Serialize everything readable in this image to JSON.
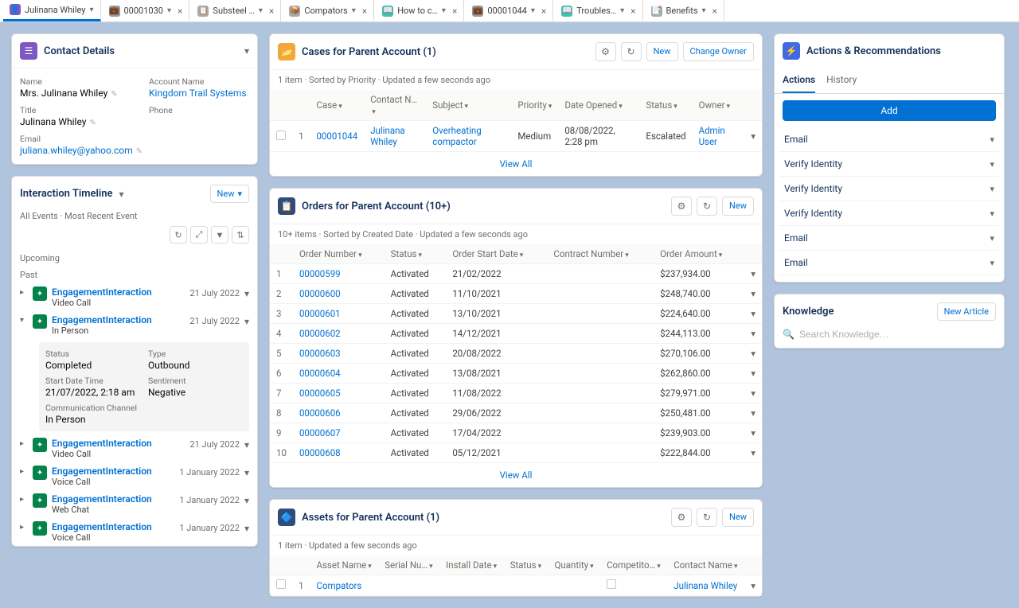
{
  "tabs": [
    {
      "label": "Julinana Whiley",
      "icon": "👤",
      "color": "#7f57c4",
      "close": false,
      "active": true
    },
    {
      "label": "00001030",
      "icon": "💼",
      "color": "#999",
      "close": true
    },
    {
      "label": "Substeel …",
      "icon": "📋",
      "color": "#aaa",
      "close": true
    },
    {
      "label": "Compators",
      "icon": "📦",
      "color": "#aaa",
      "close": true
    },
    {
      "label": "How to c…",
      "icon": "📖",
      "color": "#3cc2b3",
      "close": true
    },
    {
      "label": "00001044",
      "icon": "💼",
      "color": "#999",
      "close": true
    },
    {
      "label": "Troubles…",
      "icon": "📖",
      "color": "#3cc2b3",
      "close": true
    },
    {
      "label": "Benefits",
      "icon": "📑",
      "color": "#aaa",
      "close": true
    }
  ],
  "contactDetails": {
    "title": "Contact Details",
    "fields": {
      "name": {
        "label": "Name",
        "value": "Mrs. Julinana Whiley"
      },
      "account": {
        "label": "Account Name",
        "value": "Kingdom Trail Systems",
        "link": true
      },
      "title": {
        "label": "Title",
        "value": "Julinana Whiley"
      },
      "phone": {
        "label": "Phone",
        "value": ""
      },
      "email": {
        "label": "Email",
        "value": "juliana.whiley@yahoo.com",
        "link": true
      }
    }
  },
  "timeline": {
    "title": "Interaction Timeline",
    "newLabel": "New",
    "filterNote": "All Events · Most Recent Event",
    "sections": {
      "upcoming": "Upcoming",
      "past": "Past"
    },
    "items": [
      {
        "exp": ">",
        "title": "EngagementInteraction",
        "sub": "Video Call",
        "date": "21 July 2022"
      },
      {
        "exp": "v",
        "title": "EngagementInteraction",
        "sub": "In Person",
        "date": "21 July 2022",
        "detail": {
          "status": {
            "label": "Status",
            "value": "Completed"
          },
          "type": {
            "label": "Type",
            "value": "Outbound"
          },
          "start": {
            "label": "Start Date Time",
            "value": "21/07/2022, 2:18 am"
          },
          "sentiment": {
            "label": "Sentiment",
            "value": "Negative"
          },
          "channel": {
            "label": "Communication Channel",
            "value": "In Person"
          }
        }
      },
      {
        "exp": ">",
        "title": "EngagementInteraction",
        "sub": "Video Call",
        "date": "21 July 2022"
      },
      {
        "exp": ">",
        "title": "EngagementInteraction",
        "sub": "Voice Call",
        "date": "1 January 2022"
      },
      {
        "exp": ">",
        "title": "EngagementInteraction",
        "sub": "Web Chat",
        "date": "1 January 2022"
      },
      {
        "exp": ">",
        "title": "EngagementInteraction",
        "sub": "Voice Call",
        "date": "1 January 2022"
      }
    ]
  },
  "cases": {
    "title": "Cases for Parent Account (1)",
    "sub": "1 item · Sorted by Priority · Updated a few seconds ago",
    "btns": {
      "gear": "⚙",
      "refresh": "↻",
      "new": "New",
      "changeOwner": "Change Owner"
    },
    "cols": [
      "Case",
      "Contact N…",
      "Subject",
      "Priority",
      "Date Opened",
      "Status",
      "Owner"
    ],
    "row": {
      "idx": "1",
      "case": "00001044",
      "contact": "Julinana Whiley",
      "subject": "Overheating compactor",
      "priority": "Medium",
      "date": "08/08/2022, 2:28 pm",
      "status": "Escalated",
      "owner": "Admin User"
    },
    "viewAll": "View All"
  },
  "orders": {
    "title": "Orders for Parent Account (10+)",
    "sub": "10+ items · Sorted by Created Date · Updated a few seconds ago",
    "btns": {
      "gear": "⚙",
      "refresh": "↻",
      "new": "New"
    },
    "cols": [
      "Order Number",
      "Status",
      "Order Start Date",
      "Contract Number",
      "Order Amount"
    ],
    "rows": [
      {
        "idx": "1",
        "num": "00000599",
        "status": "Activated",
        "date": "21/02/2022",
        "contract": "",
        "amt": "$237,934.00"
      },
      {
        "idx": "2",
        "num": "00000600",
        "status": "Activated",
        "date": "11/10/2021",
        "contract": "",
        "amt": "$248,740.00"
      },
      {
        "idx": "3",
        "num": "00000601",
        "status": "Activated",
        "date": "13/10/2021",
        "contract": "",
        "amt": "$224,640.00"
      },
      {
        "idx": "4",
        "num": "00000602",
        "status": "Activated",
        "date": "14/12/2021",
        "contract": "",
        "amt": "$244,113.00"
      },
      {
        "idx": "5",
        "num": "00000603",
        "status": "Activated",
        "date": "20/08/2022",
        "contract": "",
        "amt": "$270,106.00"
      },
      {
        "idx": "6",
        "num": "00000604",
        "status": "Activated",
        "date": "13/08/2021",
        "contract": "",
        "amt": "$262,860.00"
      },
      {
        "idx": "7",
        "num": "00000605",
        "status": "Activated",
        "date": "11/08/2022",
        "contract": "",
        "amt": "$279,971.00"
      },
      {
        "idx": "8",
        "num": "00000606",
        "status": "Activated",
        "date": "29/06/2022",
        "contract": "",
        "amt": "$250,481.00"
      },
      {
        "idx": "9",
        "num": "00000607",
        "status": "Activated",
        "date": "17/04/2022",
        "contract": "",
        "amt": "$239,903.00"
      },
      {
        "idx": "10",
        "num": "00000608",
        "status": "Activated",
        "date": "05/12/2021",
        "contract": "",
        "amt": "$222,844.00"
      }
    ],
    "viewAll": "View All"
  },
  "assets": {
    "title": "Assets for Parent Account (1)",
    "sub": "1 item · Updated a few seconds ago",
    "btns": {
      "gear": "⚙",
      "refresh": "↻",
      "new": "New"
    },
    "cols": [
      "Asset Name",
      "Serial Nu…",
      "Install Date",
      "Status",
      "Quantity",
      "Competito…",
      "Contact Name"
    ],
    "row": {
      "idx": "1",
      "name": "Compators",
      "serial": "",
      "install": "",
      "status": "",
      "qty": "",
      "comp": "",
      "contact": "Julinana Whiley"
    }
  },
  "actions": {
    "title": "Actions & Recommendations",
    "tabs": {
      "actions": "Actions",
      "history": "History"
    },
    "add": "Add",
    "items": [
      "Email",
      "Verify Identity",
      "Verify Identity",
      "Verify Identity",
      "Email",
      "Email"
    ]
  },
  "knowledge": {
    "title": "Knowledge",
    "newLabel": "New Article",
    "placeholder": "Search Knowledge…"
  }
}
